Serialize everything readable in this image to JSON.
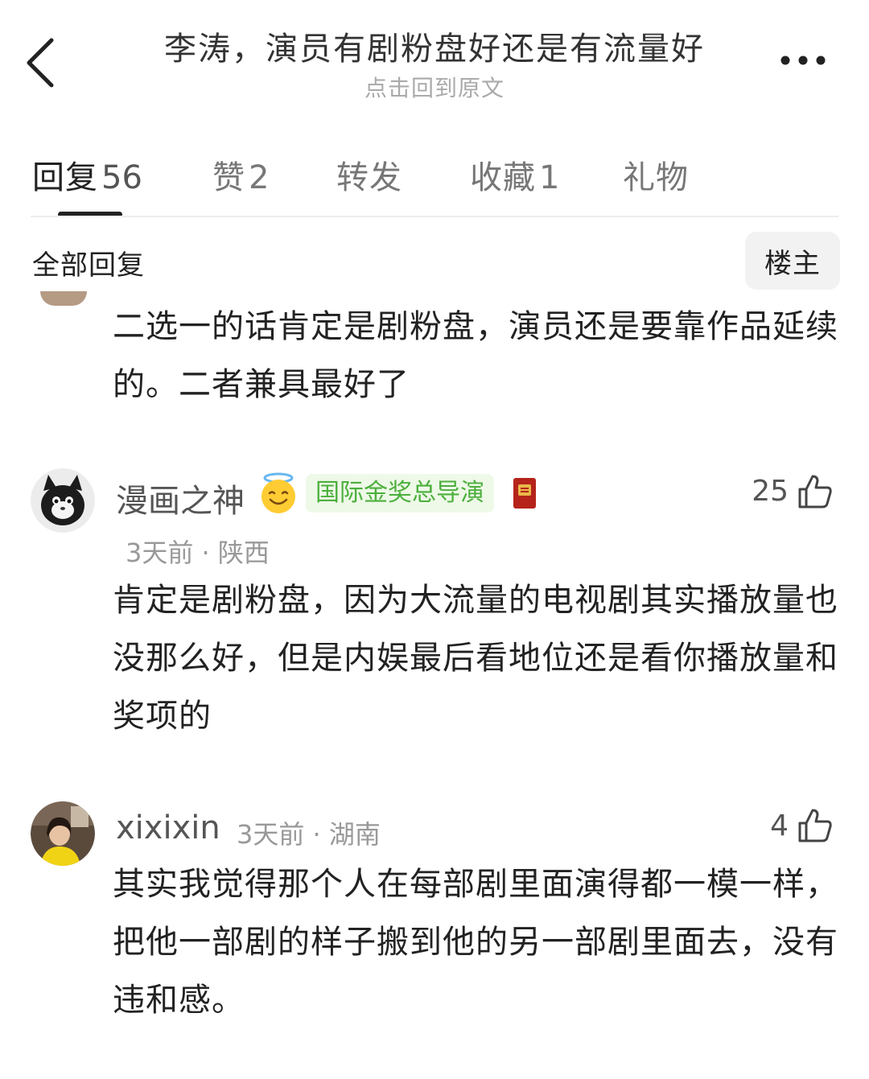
{
  "header": {
    "title": "李涛，演员有剧粉盘好还是有流量好",
    "subtitle": "点击回到原文"
  },
  "tabs": [
    {
      "label": "回复",
      "count": "56"
    },
    {
      "label": "赞",
      "count": "2"
    },
    {
      "label": "转发",
      "count": ""
    },
    {
      "label": "收藏",
      "count": "1"
    },
    {
      "label": "礼物",
      "count": ""
    }
  ],
  "section": {
    "title": "全部回复",
    "owner_button": "楼主"
  },
  "comments": [
    {
      "text": "二选一的话肯定是剧粉盘，演员还是要靠作品延续的。二者兼具最好了"
    },
    {
      "username": "漫画之神",
      "badge": "国际金奖总导演",
      "time": "3天前",
      "location": "陕西",
      "likes": "25",
      "text": "肯定是剧粉盘，因为大流量的电视剧其实播放量也没那么好，但是内娱最后看地位还是看你播放量和奖项的"
    },
    {
      "username": "xixixin",
      "time": "3天前",
      "location": "湖南",
      "likes": "4",
      "text": "其实我觉得那个人在每部剧里面演得都一模一样，把他一部剧的样子搬到他的另一部剧里面去，没有违和感。"
    }
  ],
  "meta_separator": "·",
  "colors": {
    "badge_text": "#4caf3c",
    "badge_bg": "#eef9e8",
    "meta_text": "#999999",
    "active_tab": "#222222"
  }
}
